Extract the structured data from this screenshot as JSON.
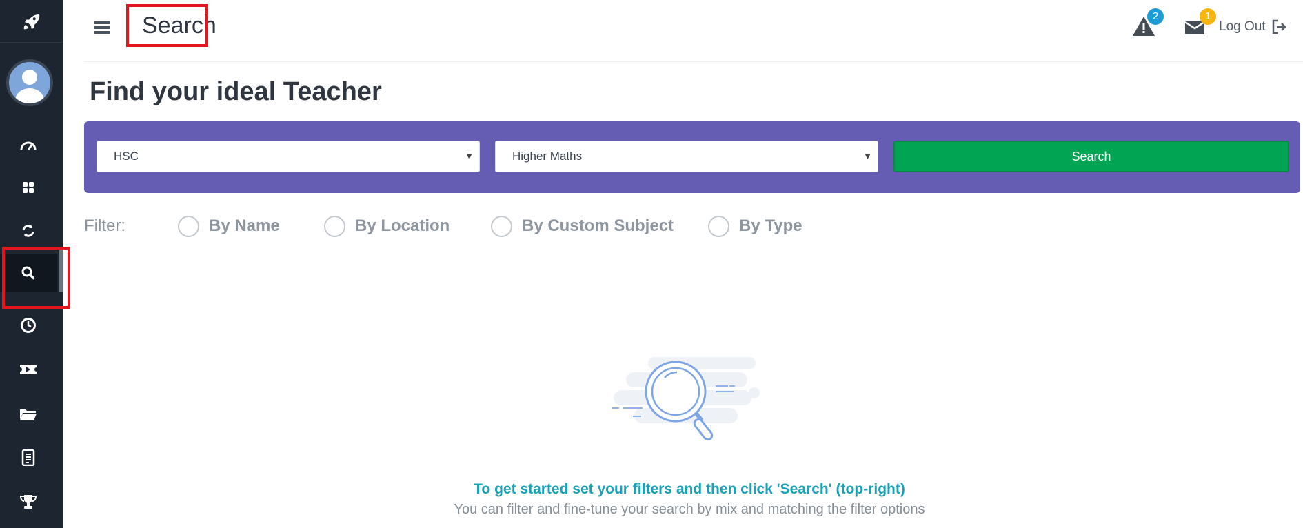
{
  "header": {
    "title": "Search",
    "alerts_count": "2",
    "messages_count": "1",
    "logout_label": "Log Out"
  },
  "main": {
    "heading": "Find your ideal Teacher",
    "level_select": {
      "value": "HSC"
    },
    "subject_select": {
      "value": "Higher Maths"
    },
    "search_button": "Search",
    "filter_label": "Filter:",
    "filters": [
      {
        "label": "By Name"
      },
      {
        "label": "By Location"
      },
      {
        "label": "By Custom Subject"
      },
      {
        "label": "By Type"
      }
    ],
    "empty_state": {
      "primary": "To get started set your filters and then click 'Search' (top-right)",
      "secondary": "You can filter and fine-tune your search by mix and matching the filter options"
    }
  },
  "colors": {
    "sidebar": "#1c2530",
    "search_bar": "#655db3",
    "search_button": "#01a452",
    "alert_badge": "#1e9bd7",
    "message_badge": "#f6b50f",
    "primary_message": "#17a2b8"
  },
  "icons": {
    "sidebar": [
      "rocket-icon",
      "avatar",
      "dashboard-gauge-icon",
      "grid-icon",
      "sync-icon",
      "search-icon",
      "clock-icon",
      "ticket-icon",
      "folder-icon",
      "document-icon",
      "trophy-icon"
    ],
    "header": [
      "menu-icon",
      "alert-icon",
      "mail-icon",
      "logout-icon"
    ]
  }
}
